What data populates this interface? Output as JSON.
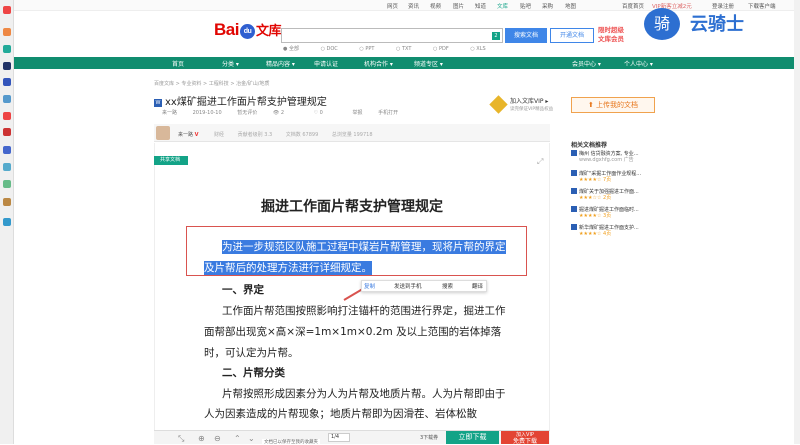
{
  "topnav": {
    "items": [
      "网页",
      "资讯",
      "视频",
      "图片",
      "知道",
      "文库",
      "贴吧",
      "采购",
      "地图"
    ],
    "right_items": [
      "百度首页",
      "VIP新客立减2元",
      "登录注册",
      "下载客户端"
    ]
  },
  "logo": {
    "bai": "Bai",
    "du": "du",
    "wenku": "文库"
  },
  "search": {
    "value": "",
    "count": "2",
    "button": "搜索文档",
    "kaitong": "开通文档"
  },
  "promo": {
    "line1": "限时超级",
    "line2": "文库会员"
  },
  "filters": [
    "全部",
    "DOC",
    "PPT",
    "TXT",
    "PDF",
    "XLS"
  ],
  "greennav": {
    "items": [
      "首页",
      "分类 ▾",
      "精品内容 ▾",
      "申请认证",
      "机构合作 ▾",
      "频道专区 ▾"
    ],
    "right": [
      "会员中心 ▾",
      "个人中心 ▾"
    ]
  },
  "breadcrumb": "百度文库 > 专业资料 > 工程科技 > 冶金/矿山/地质",
  "doc": {
    "w_icon": "W",
    "title": "xx煤矿掘进工作面片帮支护管理规定",
    "meta": [
      "来一路",
      "2019-10-10",
      "暂无评价",
      "2",
      "0",
      "举报",
      "手机打开"
    ]
  },
  "vip": {
    "line1": "加入文库VIP ▸",
    "line2": "读完保证VIP精品权益"
  },
  "upload_button": "⬆ 上传我的文档",
  "author": {
    "name": "来一路",
    "badge": "V",
    "tag": "财经",
    "stats": [
      "贡献者级别 3.3",
      "文档数 67899",
      "总浏览量 199718"
    ]
  },
  "page": {
    "tag": "共享文档",
    "heading": "掘进工作面片帮支护管理规定",
    "selected_line1": "为进一步规范区队施工过程中煤岩片帮管理，现将片帮的界定",
    "selected_line2": "及片帮后的处理方法进行详细规定。",
    "section1": "一、界定",
    "para1a": "工作面片帮范围按照影响打注锚杆的范围进行界定，掘进工作",
    "para1b": "面帮部出现宽×高×深=1m×1m×0.2m 及以上范围的岩体掉落",
    "para1c": "时，可认定为片帮。",
    "section2": "二、片帮分类",
    "para2a": "片帮按照形成因素分为人为片帮及地质片帮。人为片帮即由于",
    "para2b": "人为因素造成的片帮现象；地质片帮即为因滑茬、岩体松散"
  },
  "context_menu": [
    "复制",
    "发送到手机",
    "搜索",
    "翻译"
  ],
  "bottom": {
    "page": "1",
    "total": "/4",
    "tip": "文档已以保存至我的收藏夹",
    "price": "3下载券",
    "download": "立即下载",
    "vip_line1": "加入VIP",
    "vip_line2": "免费下载"
  },
  "related": {
    "title": "相关文档推荐",
    "items": [
      {
        "title": "梅州 信贷融资方案, 专业...",
        "sub": "www.dgxhfg.com 广告"
      },
      {
        "title": "煤矿\"采掘工作面作业规程...",
        "sub": "★★★★☆ 7页"
      },
      {
        "title": "煤矿关于加强掘进工作面...",
        "sub": "★★★☆☆ 2页"
      },
      {
        "title": "掘进煤矿掘进工作面临时...",
        "sub": "★★★★☆ 3页"
      },
      {
        "title": "新华煤矿掘进工作面支护...",
        "sub": "★★★★☆ 4页"
      }
    ]
  },
  "watermark": {
    "icon": "骑",
    "text": "云骑士"
  },
  "colors": {
    "green": "#108d6f",
    "blue": "#3f86e8",
    "red": "#d9534f",
    "selection": "#3a7be0"
  }
}
